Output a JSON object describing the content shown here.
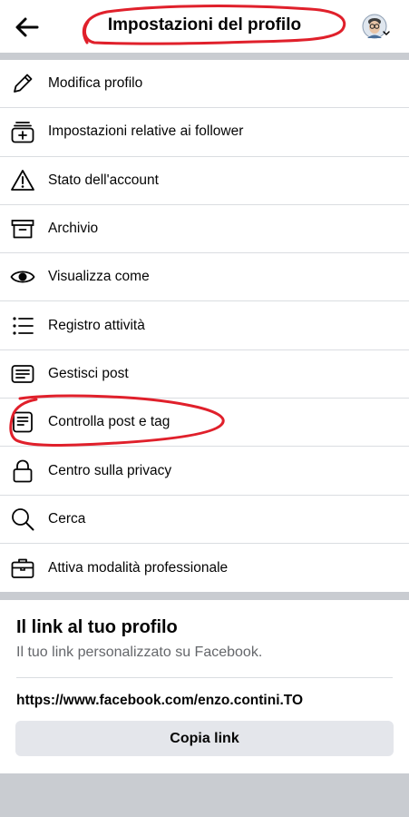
{
  "header": {
    "title": "Impostazioni del profilo",
    "back_icon": "arrow-left-icon",
    "avatar_icon": "profile-avatar-icon"
  },
  "menu": {
    "items": [
      {
        "label": "Modifica profilo",
        "icon": "pencil-icon"
      },
      {
        "label": "Impostazioni relative ai follower",
        "icon": "follower-stack-icon"
      },
      {
        "label": "Stato dell'account",
        "icon": "warning-icon"
      },
      {
        "label": "Archivio",
        "icon": "archive-box-icon"
      },
      {
        "label": "Visualizza come",
        "icon": "eye-icon"
      },
      {
        "label": "Registro attività",
        "icon": "list-icon"
      },
      {
        "label": "Gestisci post",
        "icon": "post-icon"
      },
      {
        "label": "Controlla post e tag",
        "icon": "review-post-icon"
      },
      {
        "label": "Centro sulla privacy",
        "icon": "lock-icon"
      },
      {
        "label": "Cerca",
        "icon": "search-icon"
      },
      {
        "label": "Attiva modalità professionale",
        "icon": "briefcase-icon"
      }
    ]
  },
  "profile_link": {
    "title": "Il link al tuo profilo",
    "subtitle": "Il tuo link personalizzato su Facebook.",
    "url": "https://www.facebook.com/enzo.contini.TO",
    "copy_label": "Copia link"
  },
  "colors": {
    "annotation": "#e0202b",
    "background": "#c9ccd1",
    "secondary_text": "#65676b",
    "button_bg": "#e4e6eb"
  }
}
